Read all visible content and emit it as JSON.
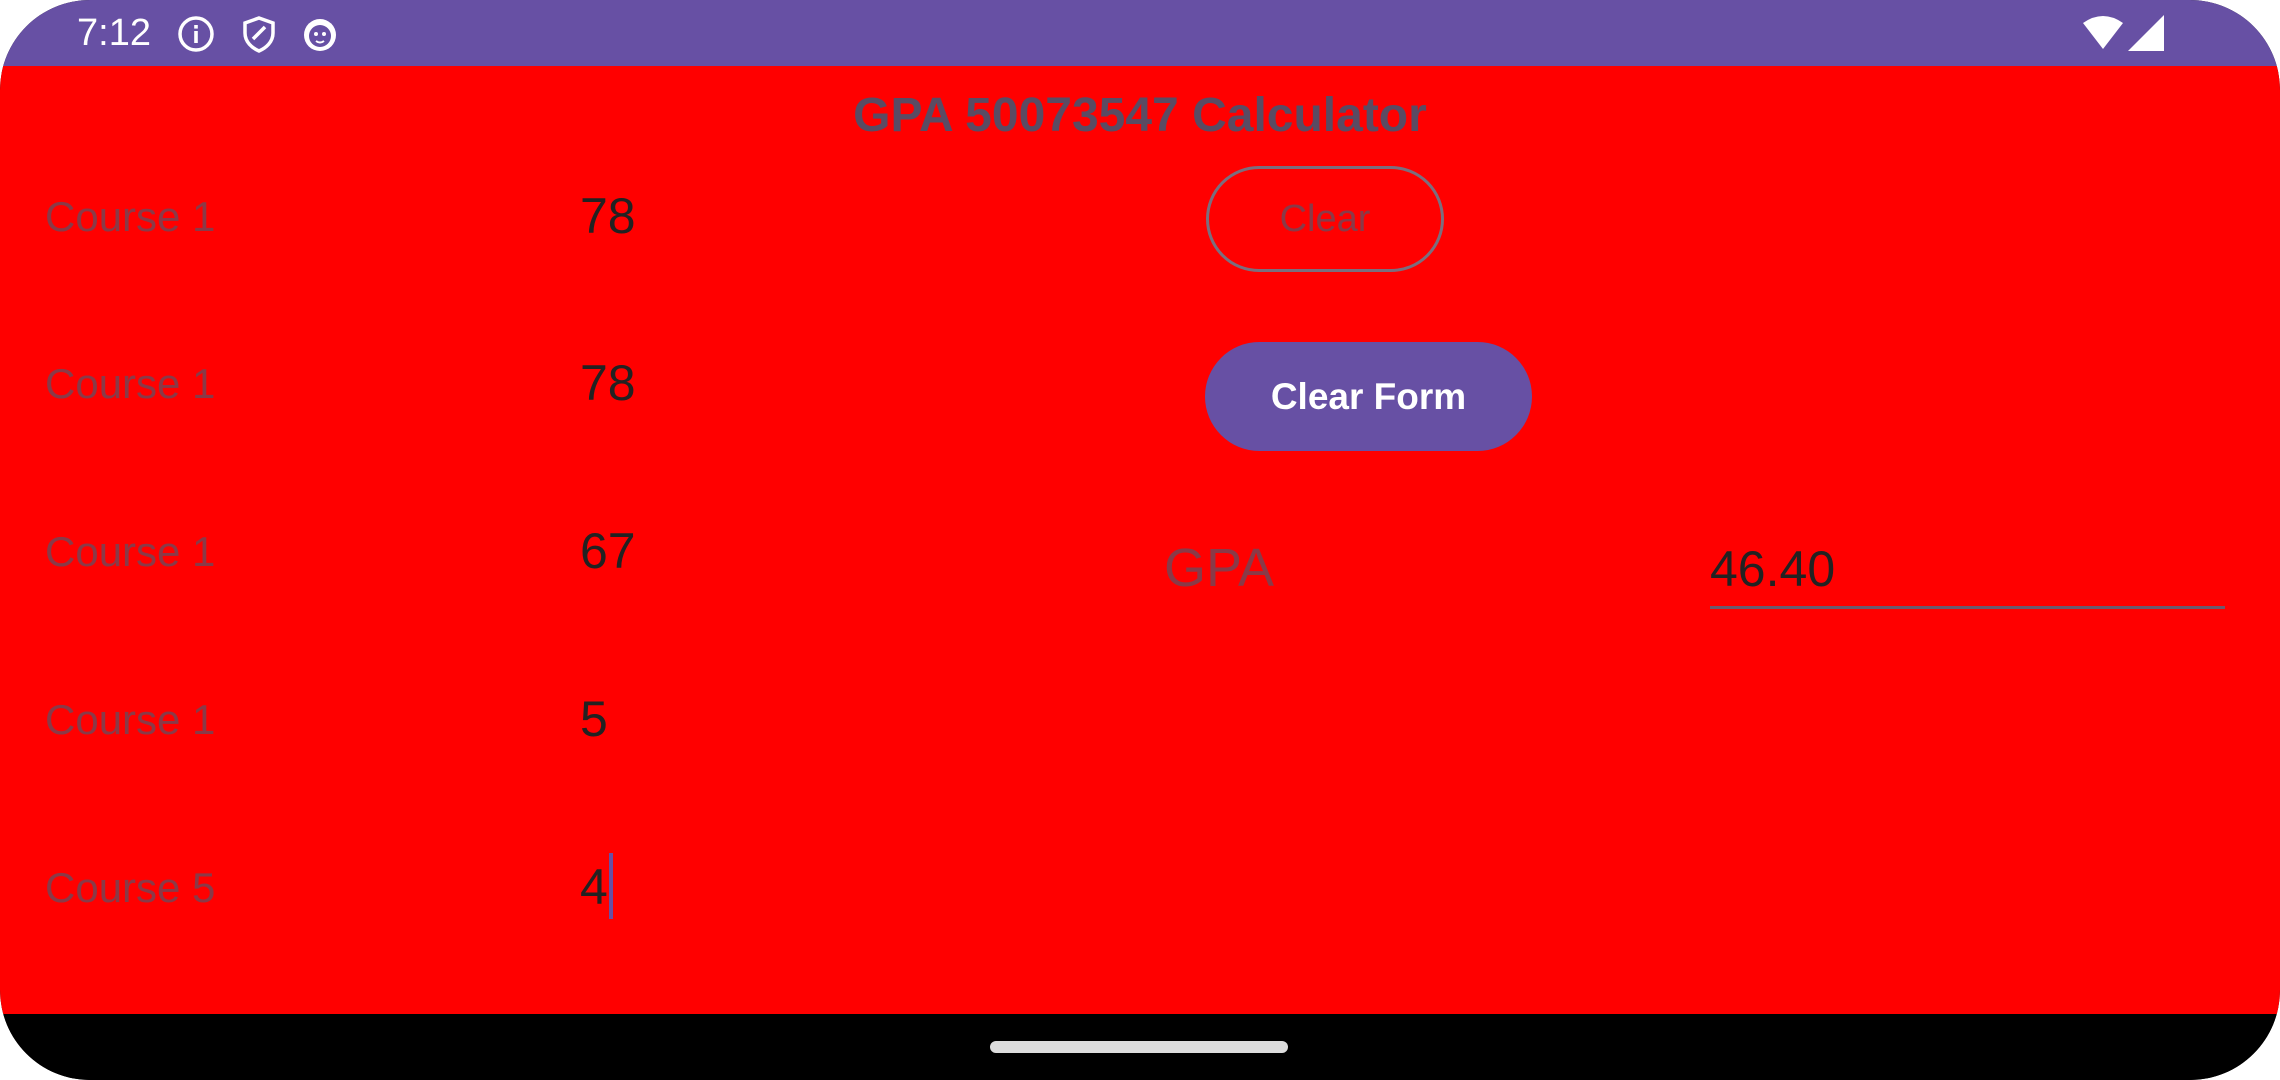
{
  "status_bar": {
    "time": "7:12",
    "icons": [
      "info-icon",
      "shield-icon",
      "cat-face-icon",
      "wifi-icon",
      "cellular-signal-icon"
    ]
  },
  "app": {
    "title": "GPA 50073547 Calculator",
    "background_color": "#FF0000",
    "accent_color": "#6750A4",
    "courses": [
      {
        "label": "Course 1",
        "value": "78"
      },
      {
        "label": "Course 1",
        "value": "78"
      },
      {
        "label": "Course 1",
        "value": "67"
      },
      {
        "label": "Course 1",
        "value": "5"
      },
      {
        "label": "Course 5",
        "value": "4"
      }
    ],
    "clear_button_label": "Clear",
    "clear_form_button_label": "Clear Form",
    "gpa_label": "GPA",
    "gpa_value": "46.40"
  }
}
